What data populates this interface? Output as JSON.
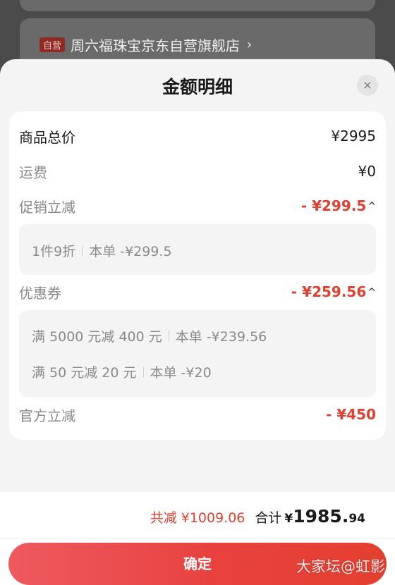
{
  "background": {
    "store_tag": "自营",
    "store_name": "周六福珠宝京东自营旗舰店",
    "store_chevron": "›"
  },
  "sheet": {
    "title": "金额明细",
    "close_icon": "×"
  },
  "rows": {
    "goods_total": {
      "label": "商品总价",
      "value": "¥2995"
    },
    "shipping": {
      "label": "运费",
      "value": "¥0"
    },
    "promo": {
      "label": "促销立减",
      "value": "- ¥299.5",
      "caret": "^"
    },
    "coupon": {
      "label": "优惠券",
      "value": "- ¥259.56",
      "caret": "^"
    },
    "official": {
      "label": "官方立减",
      "value": "- ¥450"
    }
  },
  "promo_details": [
    {
      "name": "1件9折",
      "amount": "本单 -¥299.5"
    }
  ],
  "coupon_details": [
    {
      "name": "满 5000 元减 400 元",
      "amount": "本单 -¥239.56"
    },
    {
      "name": "满 50 元减 20 元",
      "amount": "本单 -¥20"
    }
  ],
  "footer": {
    "total_reduce": "共减 ¥1009.06",
    "total_label": "合计",
    "total_currency": "¥",
    "total_int": "1985.",
    "total_dec": "94",
    "confirm_label": "确定"
  },
  "watermark": "大家坛@虹影",
  "colors": {
    "accent_red": "#e0402f",
    "button_gradient_start": "#ee5a5f",
    "button_gradient_end": "#e4402f"
  }
}
